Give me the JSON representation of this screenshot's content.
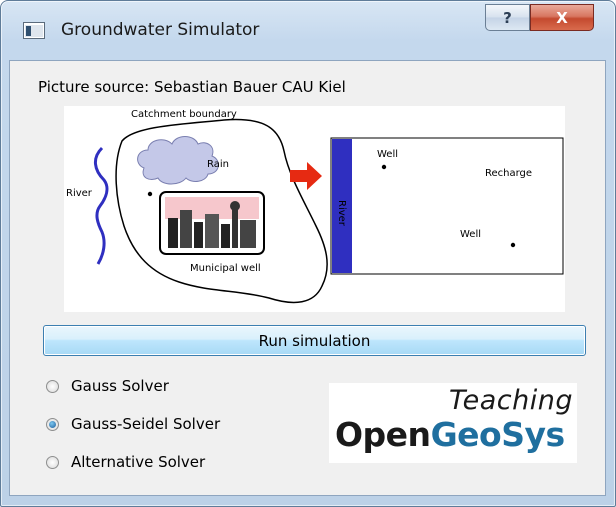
{
  "window": {
    "title": "Groundwater Simulator",
    "help_symbol": "?",
    "close_symbol": "X"
  },
  "picture": {
    "source_label": "Picture source: Sebastian Bauer CAU Kiel",
    "labels": {
      "catchment": "Catchment boundary",
      "rain": "Rain",
      "river_left": "River",
      "municipal_well": "Municipal well",
      "well_top": "Well",
      "recharge": "Recharge",
      "well_bottom": "Well",
      "river_band": "River"
    }
  },
  "run_button": {
    "label": "Run simulation"
  },
  "solvers": [
    {
      "label": "Gauss Solver",
      "checked": false
    },
    {
      "label": "Gauss-Seidel Solver",
      "checked": true
    },
    {
      "label": "Alternative Solver",
      "checked": false
    }
  ],
  "logo": {
    "teaching": "Teaching",
    "open": "Open",
    "geosys": "GeoSys"
  },
  "colors": {
    "river": "#2f2fc0",
    "arrow": "#e62a12",
    "logo_geosys": "#1f6f9f",
    "cloud": "#c4c8e8"
  }
}
